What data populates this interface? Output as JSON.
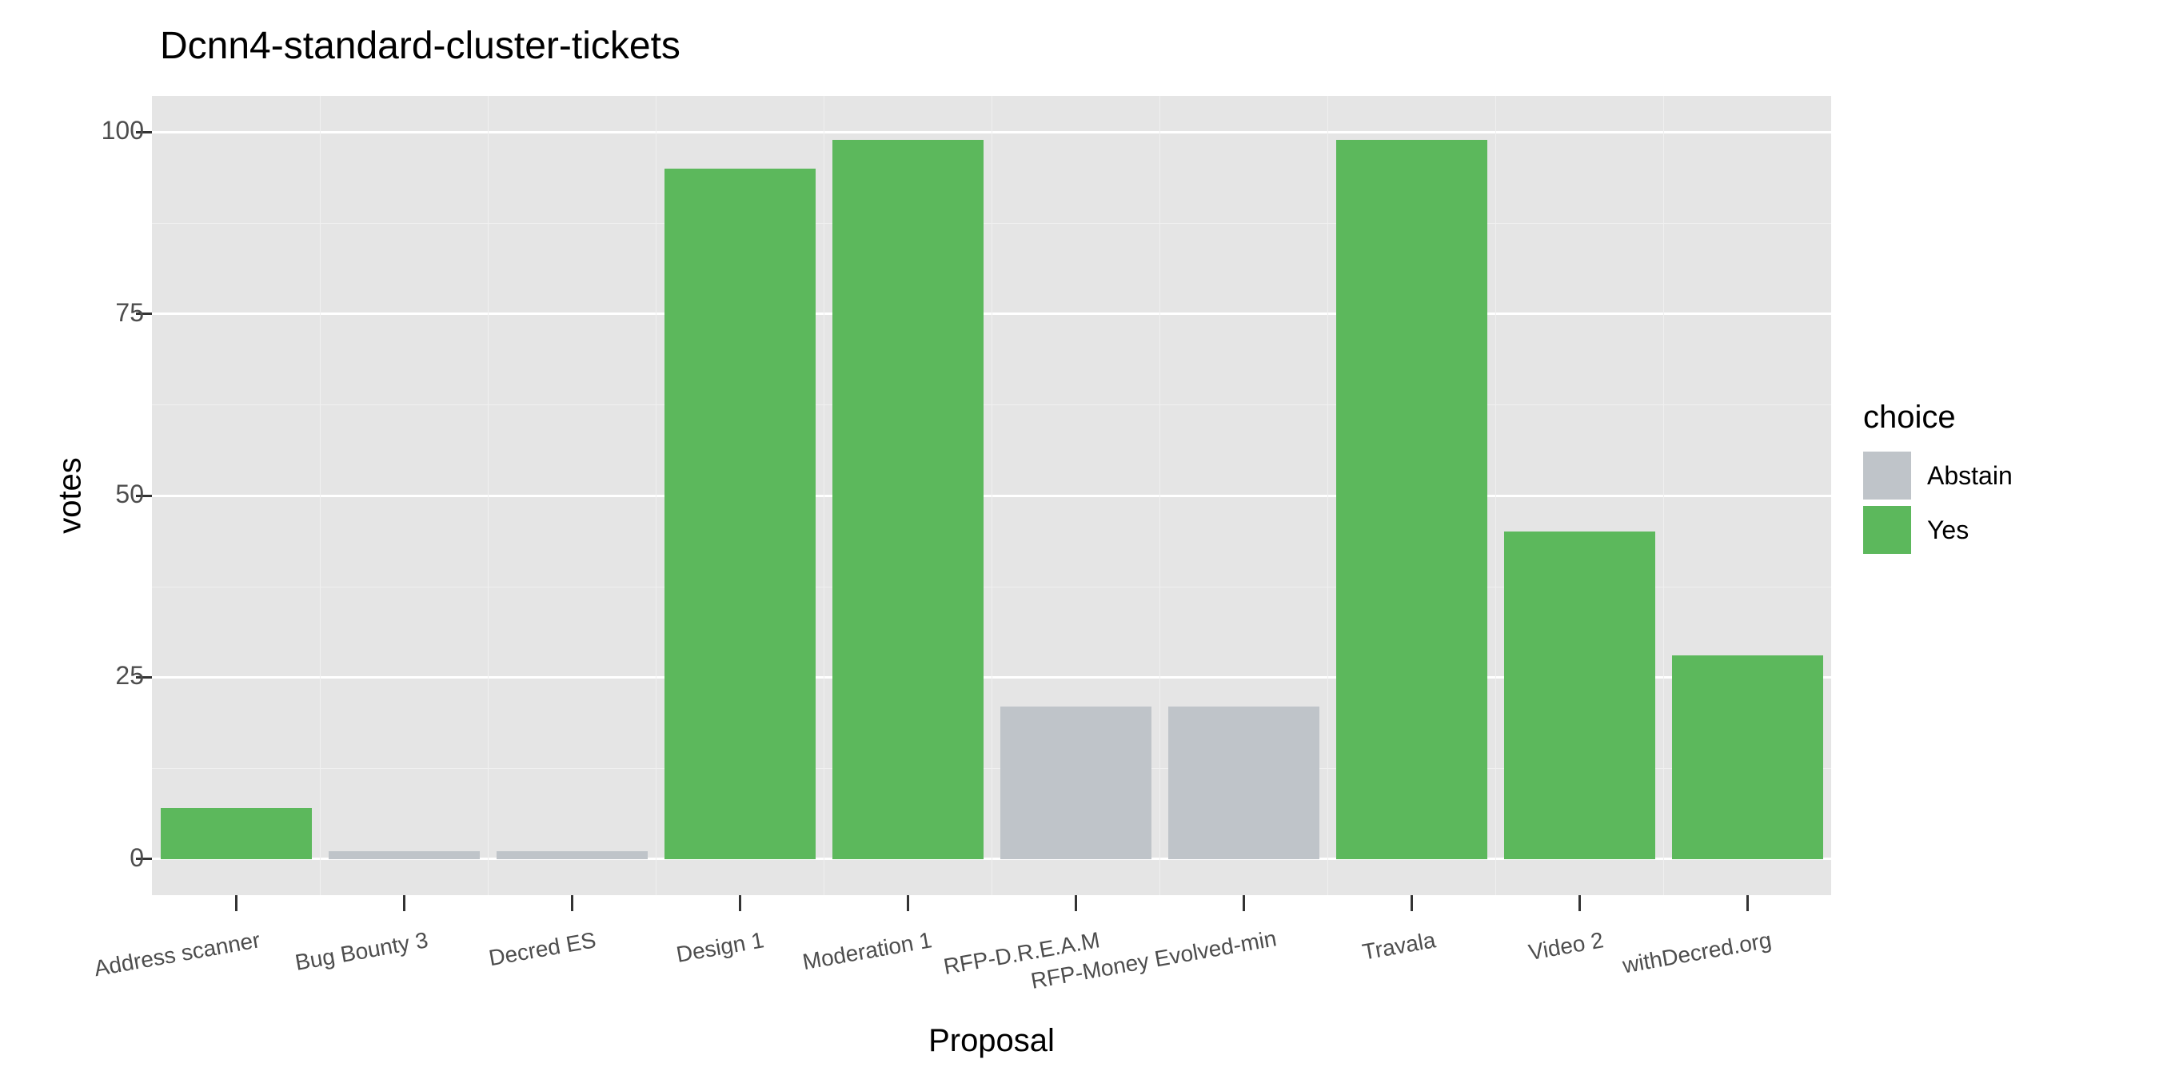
{
  "chart_data": {
    "type": "bar",
    "title": "Dcnn4-standard-cluster-tickets",
    "xlabel": "Proposal",
    "ylabel": "votes",
    "ylim": [
      0,
      100
    ],
    "yticks": [
      0,
      25,
      50,
      75,
      100
    ],
    "legend_title": "choice",
    "categories": [
      "Address scanner",
      "Bug Bounty 3",
      "Decred ES",
      "Design 1",
      "Moderation 1",
      "RFP-D.R.E.A.M",
      "RFP-Money Evolved-min",
      "Travala",
      "Video 2",
      "withDecred.org"
    ],
    "series": [
      {
        "name": "Abstain",
        "color": "#bfc4c9"
      },
      {
        "name": "Yes",
        "color": "#5cb85c"
      }
    ],
    "bars": [
      {
        "category": "Address scanner",
        "choice": "Yes",
        "value": 7
      },
      {
        "category": "Bug Bounty 3",
        "choice": "Abstain",
        "value": 1
      },
      {
        "category": "Decred ES",
        "choice": "Abstain",
        "value": 1
      },
      {
        "category": "Design 1",
        "choice": "Yes",
        "value": 95
      },
      {
        "category": "Moderation 1",
        "choice": "Yes",
        "value": 99
      },
      {
        "category": "RFP-D.R.E.A.M",
        "choice": "Abstain",
        "value": 21
      },
      {
        "category": "RFP-Money Evolved-min",
        "choice": "Abstain",
        "value": 21
      },
      {
        "category": "Travala",
        "choice": "Yes",
        "value": 99
      },
      {
        "category": "Video 2",
        "choice": "Yes",
        "value": 45
      },
      {
        "category": "withDecred.org",
        "choice": "Yes",
        "value": 28
      }
    ]
  }
}
